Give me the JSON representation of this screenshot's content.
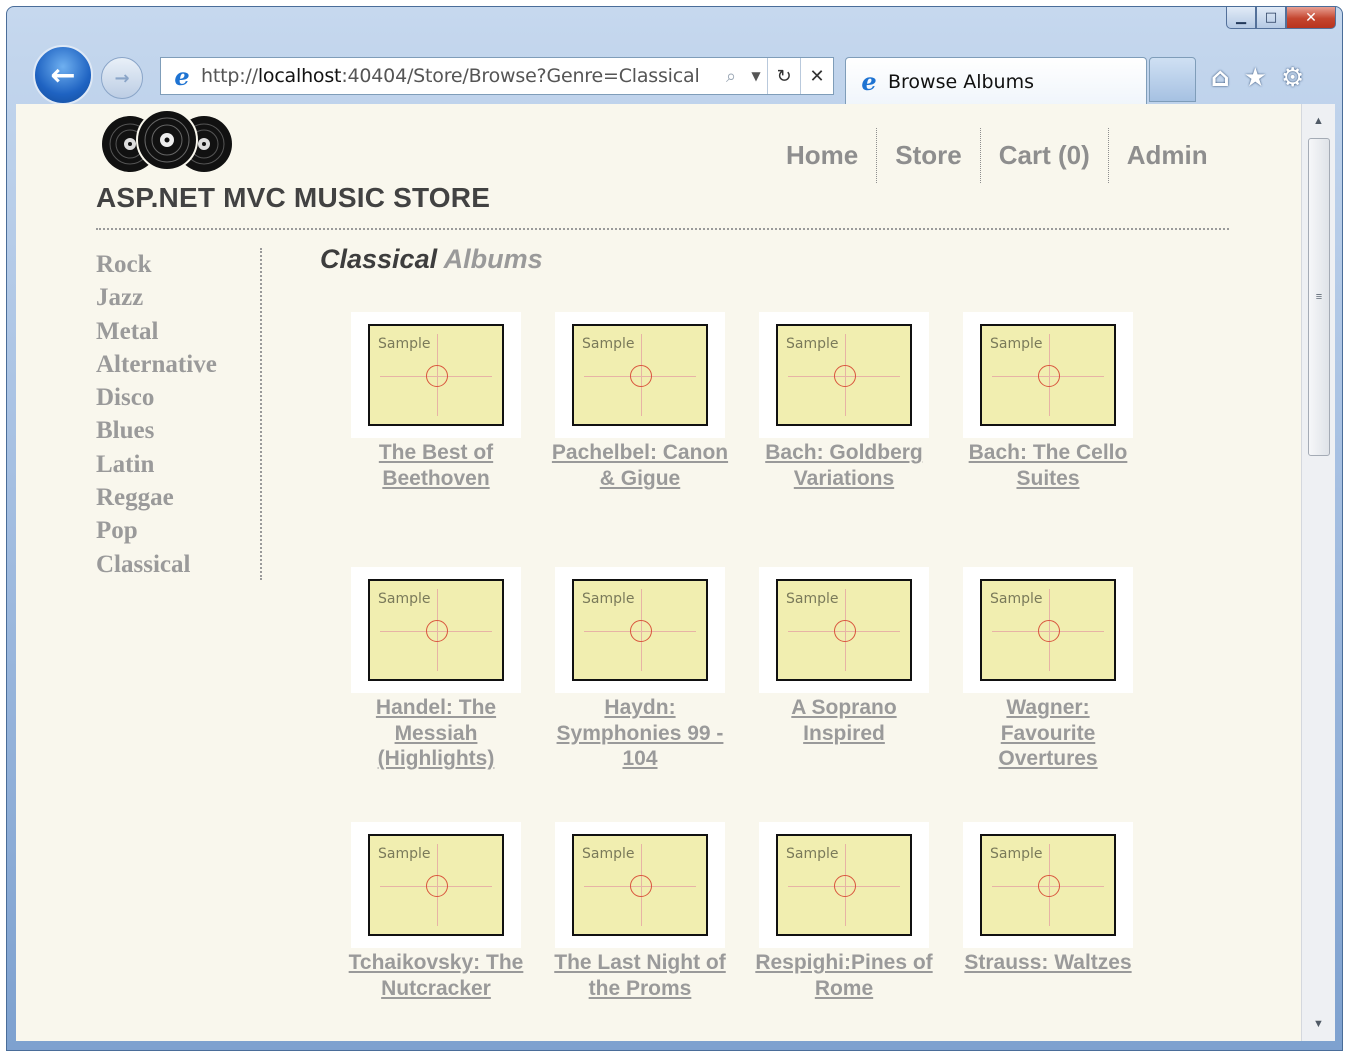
{
  "browser": {
    "address_url_prefix": "http://",
    "address_url_host": "localhost",
    "address_url_rest": ":40404/Store/Browse?Genre=Classical",
    "tab_title": "Browse Albums",
    "window_controls": {
      "minimize": "▁",
      "maximize": "□",
      "close": "✕"
    },
    "icons": {
      "back": "arrow-left-icon",
      "forward": "arrow-right-icon",
      "search": "search-icon",
      "dropdown": "chevron-down-icon",
      "refresh": "refresh-icon",
      "stop": "close-icon",
      "home": "home-icon",
      "favorites": "star-icon",
      "tools": "gear-icon"
    }
  },
  "site": {
    "title": "ASP.NET MVC MUSIC STORE",
    "nav": [
      "Home",
      "Store",
      "Cart (0)",
      "Admin"
    ]
  },
  "genres": [
    "Rock",
    "Jazz",
    "Metal",
    "Alternative",
    "Disco",
    "Blues",
    "Latin",
    "Reggae",
    "Pop",
    "Classical"
  ],
  "page": {
    "heading_genre": "Classical",
    "heading_suffix": "Albums"
  },
  "placeholder_text": "Sample",
  "albums": [
    "The Best of Beethoven",
    "Pachelbel: Canon & Gigue",
    "Bach: Goldberg Variations",
    "Bach: The Cello Suites",
    "Handel: The Messiah (Highlights)",
    "Haydn: Symphonies 99 - 104",
    "A Soprano Inspired",
    "Wagner: Favourite Overtures",
    "Tchaikovsky: The Nutcracker",
    "The Last Night of the Proms",
    "Respighi:Pines of Rome",
    "Strauss: Waltzes"
  ],
  "colors": {
    "page_bg": "#f9f7ed",
    "link_gray": "#9a9a9a",
    "title_dark": "#424242",
    "album_placeholder": "#f1eeb0"
  }
}
